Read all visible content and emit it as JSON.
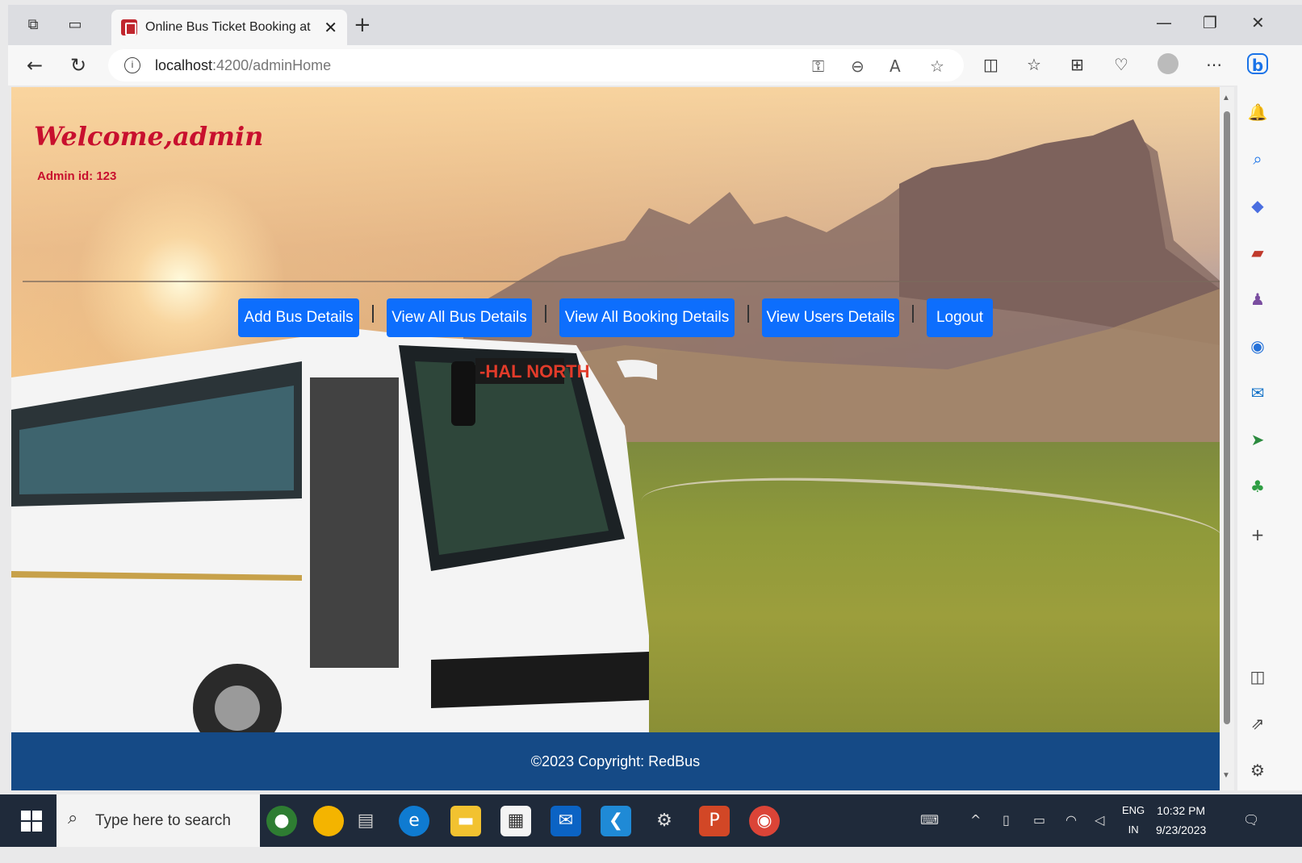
{
  "browser": {
    "tab_title": "Online Bus Ticket Booking at Lo",
    "url_host": "localhost",
    "url_path": ":4200/adminHome"
  },
  "page": {
    "welcome": "Welcome,admin",
    "admin_id": "Admin id: 123",
    "nav": [
      {
        "label": "Add Bus Details"
      },
      {
        "label": "View All Bus Details"
      },
      {
        "label": "View All Booking Details"
      },
      {
        "label": "View Users Details"
      },
      {
        "label": "Logout"
      }
    ],
    "bus_sign": "-HAL NORTH",
    "footer": "©2023 Copyright: RedBus"
  },
  "taskbar": {
    "search_placeholder": "Type here to search",
    "lang_top": "ENG",
    "lang_bottom": "IN",
    "time": "10:32 PM",
    "date": "9/23/2023"
  },
  "colors": {
    "accent": "#0d6efd",
    "welcome_red": "#c8102e",
    "footer_blue": "#154a86"
  }
}
